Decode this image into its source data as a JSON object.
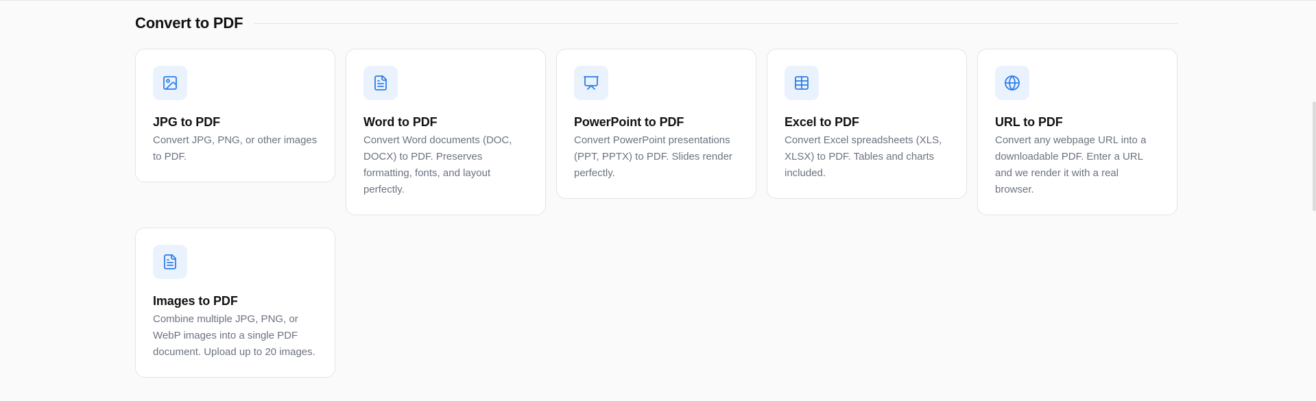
{
  "section": {
    "title": "Convert to PDF"
  },
  "accent_color": "#2b7de9",
  "icon_tile_color": "#eaf2fe",
  "cards": [
    {
      "icon": "image-icon",
      "title": "JPG to PDF",
      "description": "Convert JPG, PNG, or other images to PDF."
    },
    {
      "icon": "document-icon",
      "title": "Word to PDF",
      "description": "Convert Word documents (DOC, DOCX) to PDF. Preserves formatting, fonts, and layout perfectly."
    },
    {
      "icon": "presentation-icon",
      "title": "PowerPoint to PDF",
      "description": "Convert PowerPoint presentations (PPT, PPTX) to PDF. Slides render perfectly."
    },
    {
      "icon": "table-icon",
      "title": "Excel to PDF",
      "description": "Convert Excel spreadsheets (XLS, XLSX) to PDF. Tables and charts included."
    },
    {
      "icon": "globe-icon",
      "title": "URL to PDF",
      "description": "Convert any webpage URL into a downloadable PDF. Enter a URL and we render it with a real browser."
    },
    {
      "icon": "document-icon",
      "title": "Images to PDF",
      "description": "Combine multiple JPG, PNG, or WebP images into a single PDF document. Upload up to 20 images."
    }
  ]
}
